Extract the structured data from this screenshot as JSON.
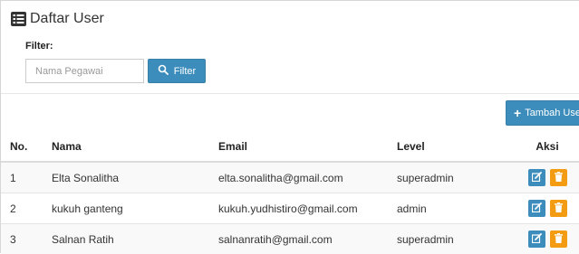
{
  "header": {
    "title": "Daftar User",
    "icon": "list-icon"
  },
  "filter": {
    "label": "Filter:",
    "placeholder": "Nama Pegawai",
    "value": "",
    "button_label": "Filter",
    "button_icon": "search-icon"
  },
  "actions": {
    "add_label": "Tambah User",
    "add_icon": "plus-icon"
  },
  "table": {
    "headers": {
      "no": "No.",
      "nama": "Nama",
      "email": "Email",
      "level": "Level",
      "aksi": "Aksi"
    },
    "rows": [
      {
        "no": "1",
        "nama": "Elta Sonalitha",
        "email": "elta.sonalitha@gmail.com",
        "level": "superadmin"
      },
      {
        "no": "2",
        "nama": "kukuh ganteng",
        "email": "kukuh.yudhistiro@gmail.com",
        "level": "admin"
      },
      {
        "no": "3",
        "nama": "Salnan Ratih",
        "email": "salnanratih@gmail.com",
        "level": "superadmin"
      }
    ],
    "row_actions": {
      "edit_icon": "edit-icon",
      "delete_icon": "trash-icon"
    }
  },
  "colors": {
    "primary": "#3c8dbc",
    "warning": "#f39c12"
  }
}
